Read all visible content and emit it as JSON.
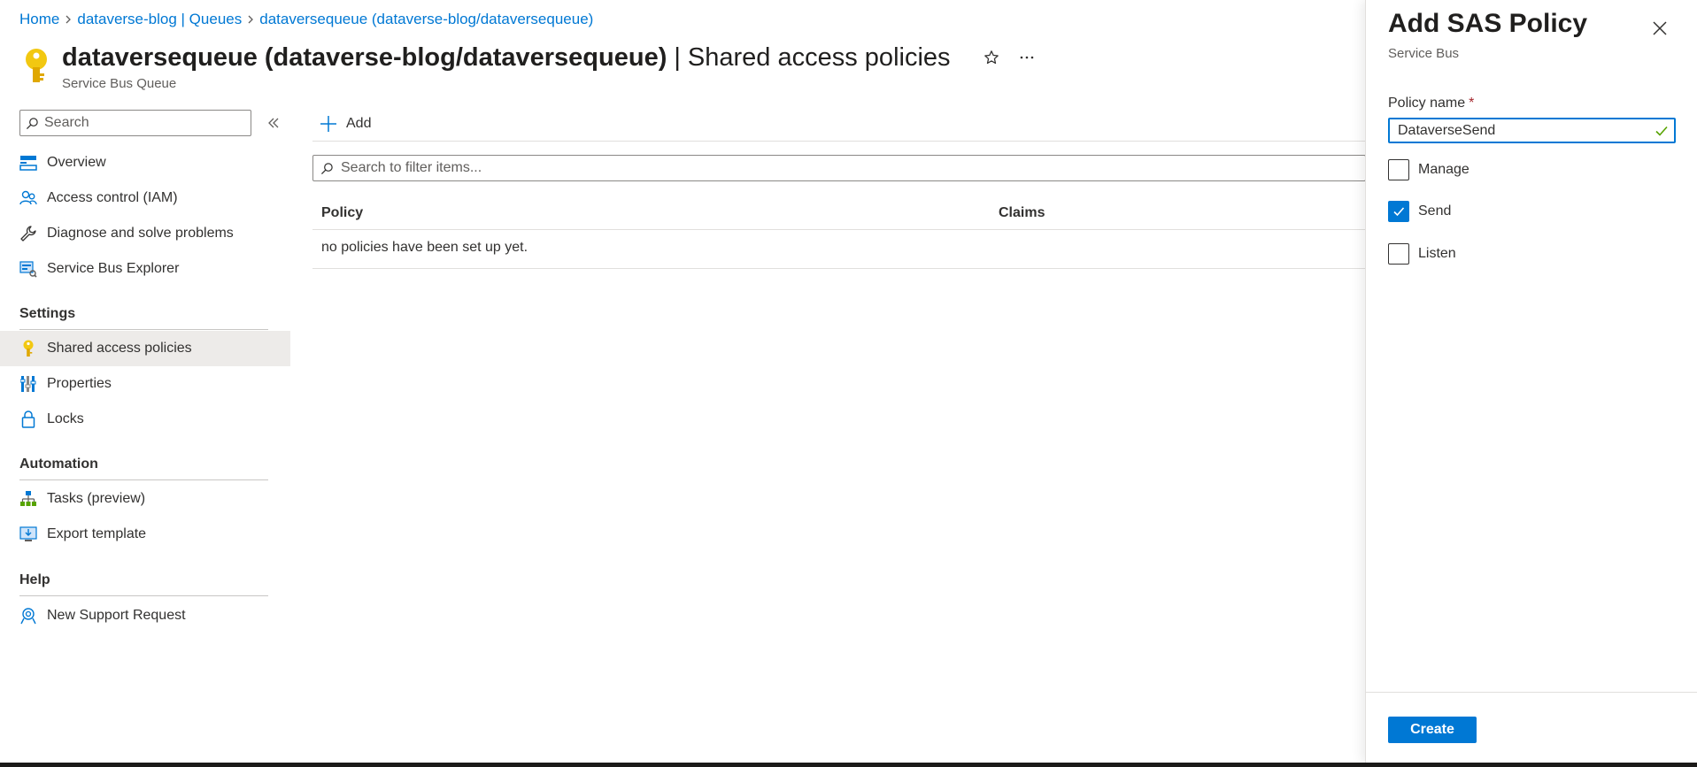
{
  "breadcrumb": {
    "items": [
      "Home",
      "dataverse-blog | Queues",
      "dataversequeue (dataverse-blog/dataversequeue)"
    ]
  },
  "header": {
    "title": "dataversequeue (dataverse-blog/dataversequeue)",
    "separator": "|",
    "section": "Shared access policies",
    "subtitle": "Service Bus Queue"
  },
  "sidebar": {
    "search_placeholder": "Search",
    "items": [
      {
        "label": "Overview"
      },
      {
        "label": "Access control (IAM)"
      },
      {
        "label": "Diagnose and solve problems"
      },
      {
        "label": "Service Bus Explorer"
      }
    ],
    "settings": {
      "title": "Settings",
      "items": [
        {
          "label": "Shared access policies"
        },
        {
          "label": "Properties"
        },
        {
          "label": "Locks"
        }
      ]
    },
    "automation": {
      "title": "Automation",
      "items": [
        {
          "label": "Tasks (preview)"
        },
        {
          "label": "Export template"
        }
      ]
    },
    "help": {
      "title": "Help",
      "items": [
        {
          "label": "New Support Request"
        }
      ]
    }
  },
  "main": {
    "add_label": "Add",
    "filter_placeholder": "Search to filter items...",
    "columns": [
      "Policy",
      "Claims"
    ],
    "empty_message": "no policies have been set up yet."
  },
  "panel": {
    "title": "Add SAS Policy",
    "subtitle": "Service Bus",
    "policy_name_label": "Policy name",
    "required_mark": "*",
    "policy_name_value": "DataverseSend",
    "checkboxes": [
      {
        "label": "Manage",
        "checked": false
      },
      {
        "label": "Send",
        "checked": true
      },
      {
        "label": "Listen",
        "checked": false
      }
    ],
    "create_label": "Create"
  },
  "colors": {
    "accent": "#0078d4",
    "key": "#f2c811",
    "selected_bg": "#edebe9",
    "required": "#a4262c",
    "valid": "#57a300"
  }
}
